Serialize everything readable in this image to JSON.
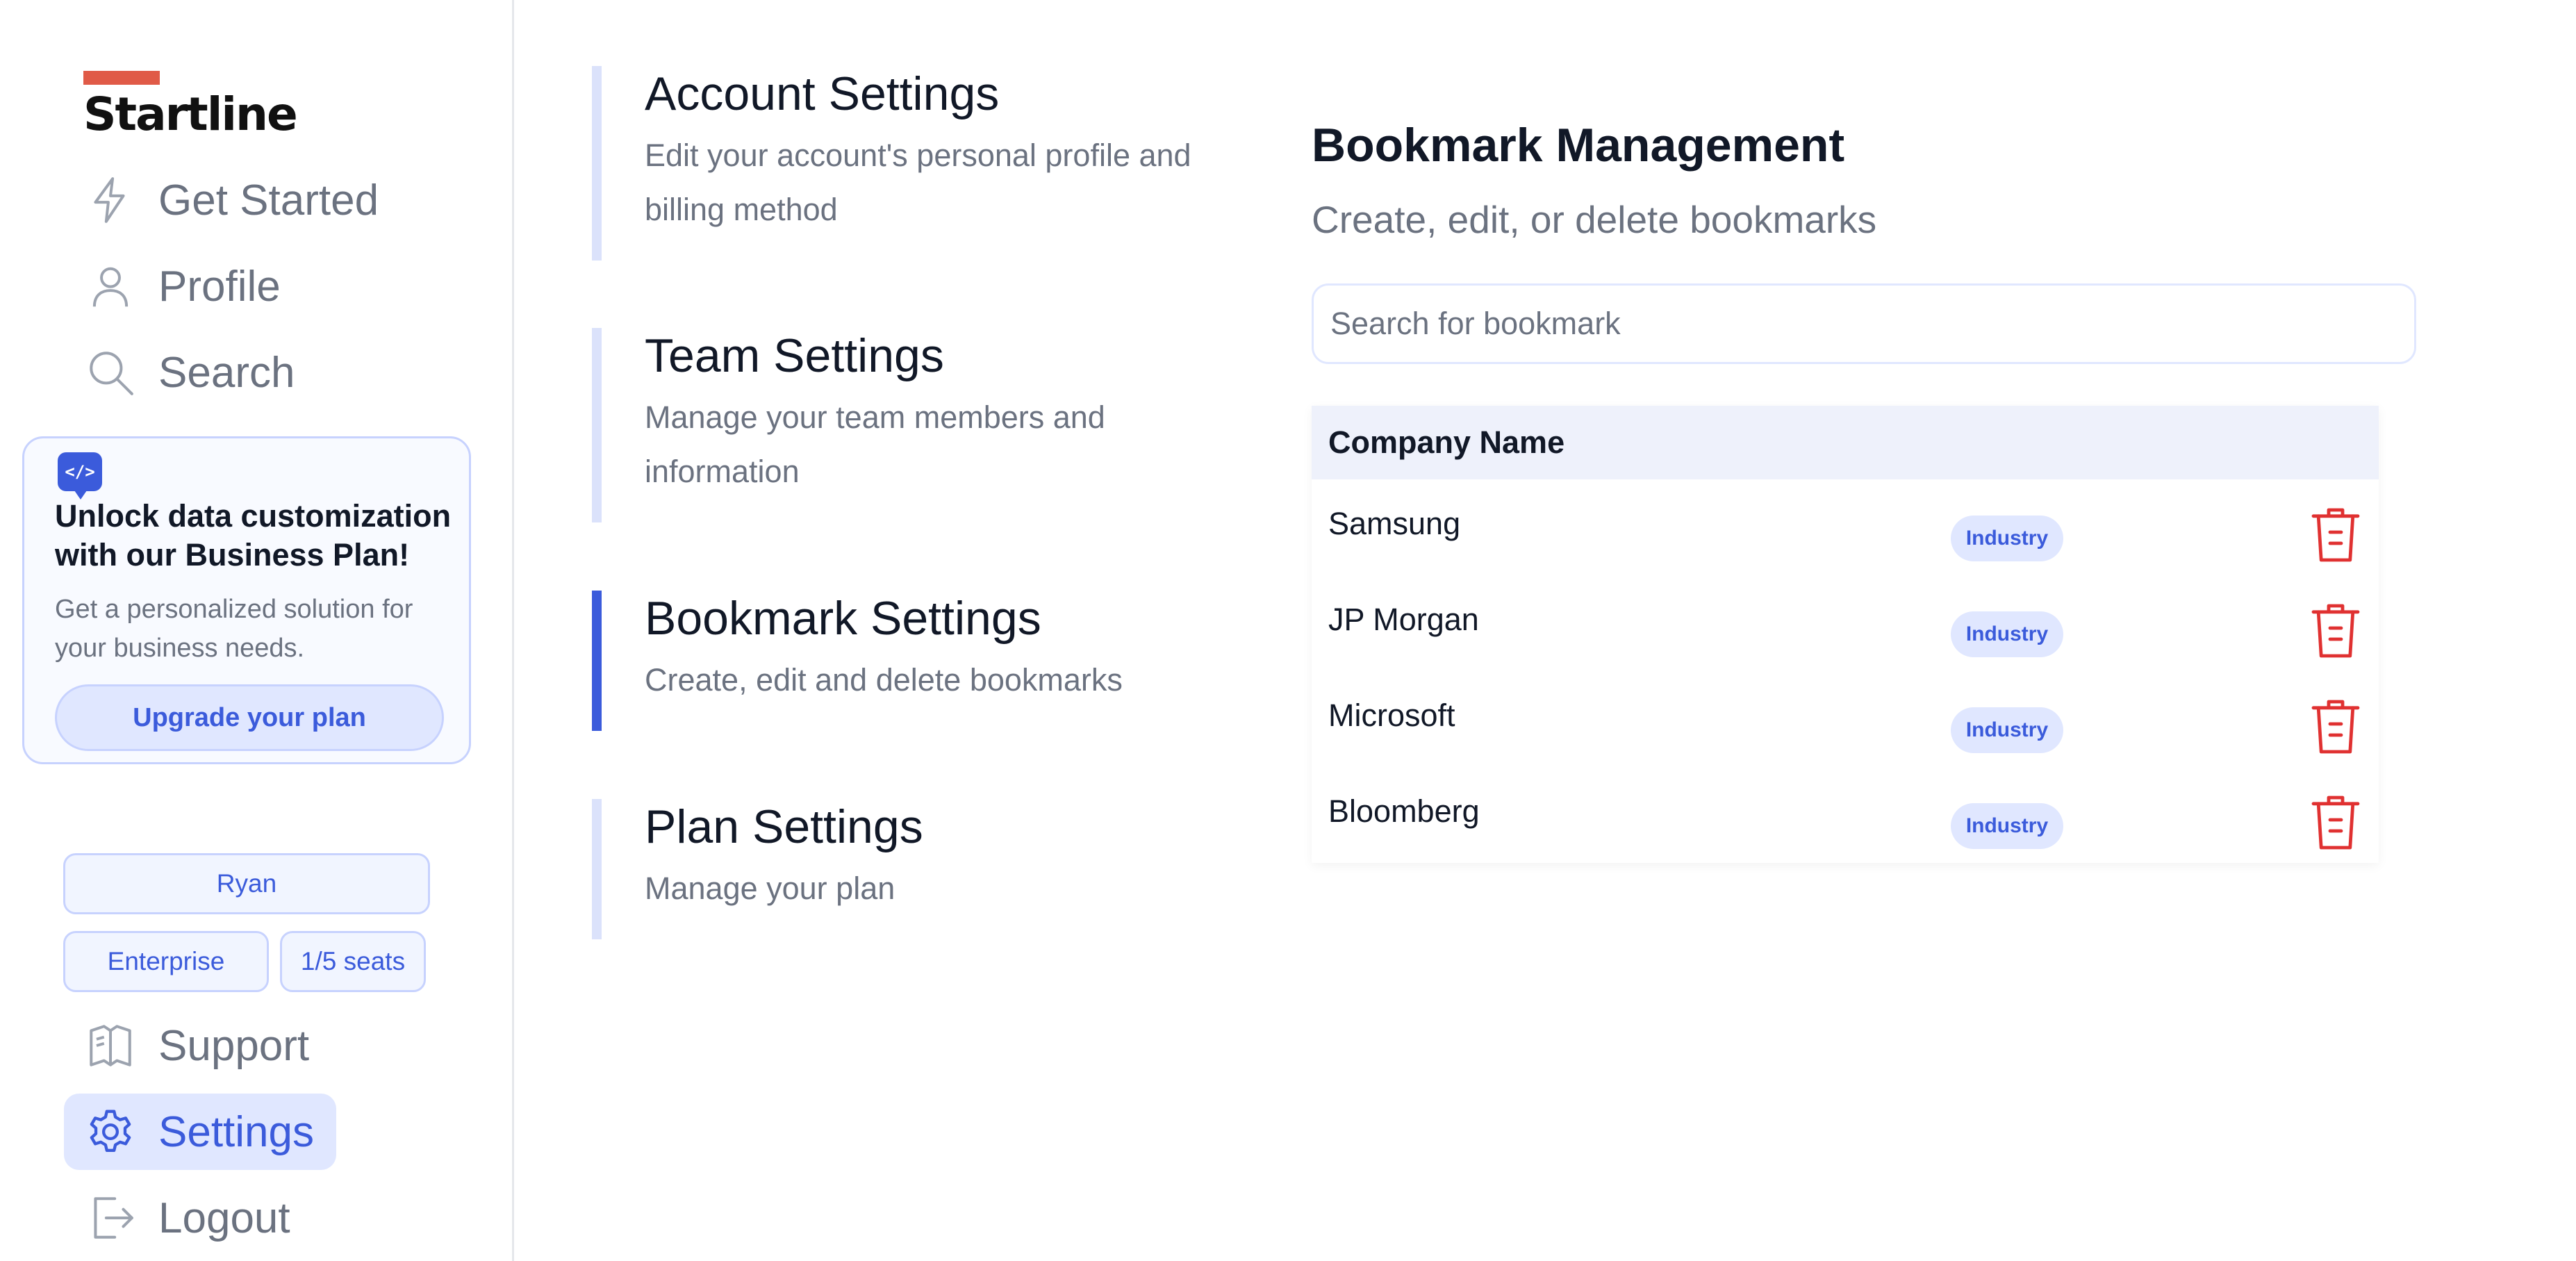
{
  "brand": {
    "name": "Startline",
    "accent_color": "#e05a47"
  },
  "sidebar": {
    "nav_top": [
      {
        "label": "Get Started",
        "icon": "bolt-icon"
      },
      {
        "label": "Profile",
        "icon": "user-icon"
      },
      {
        "label": "Search",
        "icon": "search-icon"
      }
    ],
    "promo": {
      "badge_icon": "code-chat-icon",
      "badge_text": "</>",
      "title": "Unlock data customization with our Business Plan!",
      "description": "Get a personalized solution for your business needs.",
      "button_label": "Upgrade your plan"
    },
    "user": {
      "name": "Ryan",
      "plan": "Enterprise",
      "seats": "1/5 seats"
    },
    "nav_bottom": [
      {
        "label": "Support",
        "icon": "book-icon",
        "active": false
      },
      {
        "label": "Settings",
        "icon": "gear-icon",
        "active": true
      },
      {
        "label": "Logout",
        "icon": "logout-icon",
        "active": false
      }
    ]
  },
  "settings_menu": [
    {
      "title": "Account Settings",
      "description": "Edit your account's personal profile and billing method",
      "active": false
    },
    {
      "title": "Team Settings",
      "description": "Manage your team members and information",
      "active": false
    },
    {
      "title": "Bookmark Settings",
      "description": "Create, edit and delete bookmarks",
      "active": true
    },
    {
      "title": "Plan Settings",
      "description": "Manage your plan",
      "active": false
    }
  ],
  "bookmarks": {
    "title": "Bookmark Management",
    "subtitle": "Create, edit, or delete bookmarks",
    "search_placeholder": "Search for bookmark",
    "search_value": "",
    "column_header": "Company Name",
    "rows": [
      {
        "company": "Samsung",
        "tag": "Industry"
      },
      {
        "company": "JP Morgan",
        "tag": "Industry"
      },
      {
        "company": "Microsoft",
        "tag": "Industry"
      },
      {
        "company": "Bloomberg",
        "tag": "Industry"
      }
    ],
    "delete_icon": "trash-icon",
    "delete_color": "#e03131"
  },
  "colors": {
    "primary": "#3b5bdb",
    "primary_light": "#e0e7ff",
    "muted_text": "#6b7280"
  }
}
